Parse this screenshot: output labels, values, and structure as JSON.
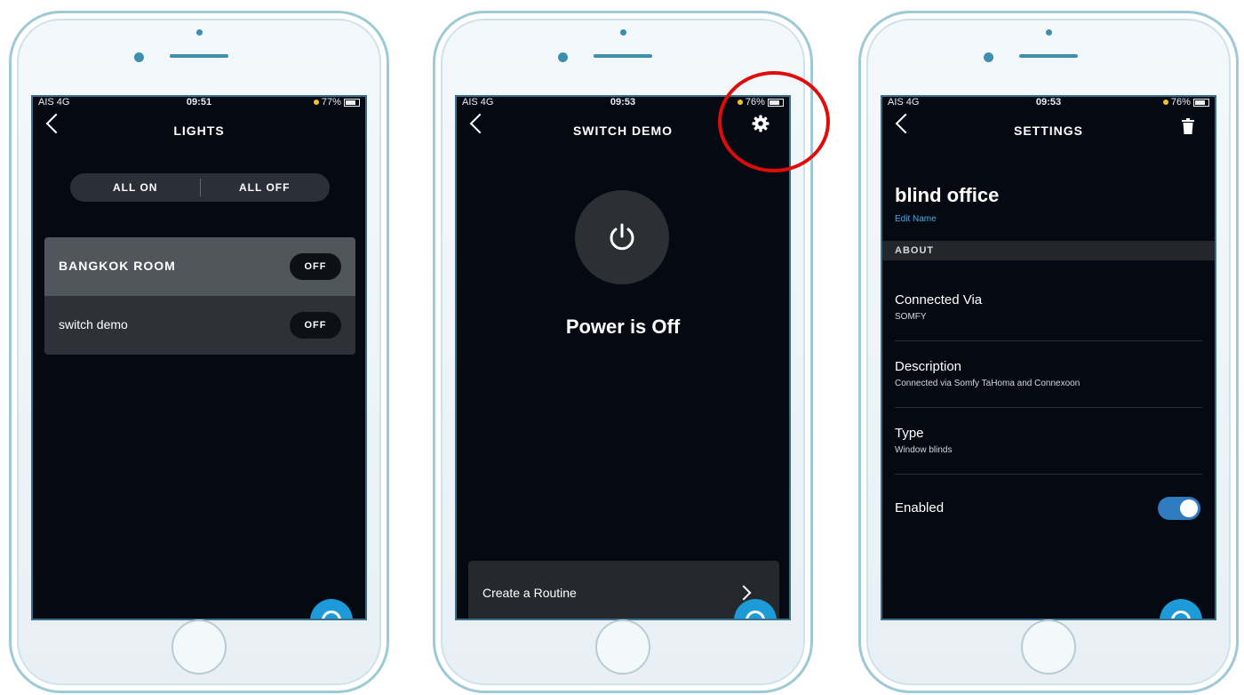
{
  "phone1": {
    "status": {
      "carrier": "AIS 4G",
      "time": "09:51",
      "battery": "77%"
    },
    "title": "LIGHTS",
    "all_on": "ALL ON",
    "all_off": "ALL OFF",
    "devices": [
      {
        "name": "BANGKOK ROOM",
        "state": "OFF"
      },
      {
        "name": "switch demo",
        "state": "OFF"
      }
    ]
  },
  "phone2": {
    "status": {
      "carrier": "AIS 4G",
      "time": "09:53",
      "battery": "76%"
    },
    "title": "SWITCH DEMO",
    "power_status": "Power is Off",
    "routine_label": "Create a Routine"
  },
  "phone3": {
    "status": {
      "carrier": "AIS 4G",
      "time": "09:53",
      "battery": "76%"
    },
    "title": "SETTINGS",
    "device_name": "blind office",
    "edit_name": "Edit Name",
    "about_header": "ABOUT",
    "rows": [
      {
        "heading": "Connected Via",
        "sub": "SOMFY"
      },
      {
        "heading": "Description",
        "sub": "Connected via Somfy TaHoma and Connexoon"
      },
      {
        "heading": "Type",
        "sub": "Window blinds"
      }
    ],
    "enabled_label": "Enabled",
    "enabled": true
  },
  "colors": {
    "accent": "#1d9bd9",
    "highlight": "#e00b0b",
    "toggle": "#2f7bbf"
  }
}
